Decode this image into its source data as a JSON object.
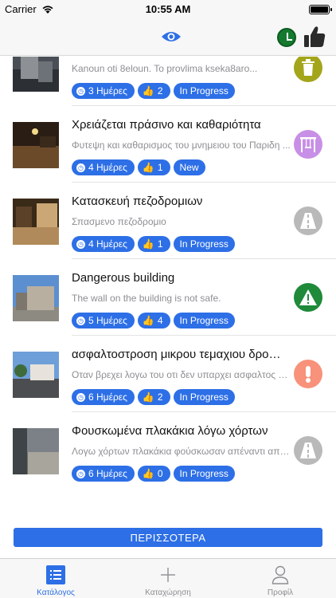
{
  "status_bar": {
    "carrier": "Carrier",
    "time": "10:55 AM"
  },
  "colors": {
    "accent": "#2d6fe6",
    "icon_eye": "#2d6fe6",
    "clock_green": "#157a2f",
    "tab_inactive": "#8e8e93"
  },
  "nav": {
    "left_icon": "eye-icon",
    "right_icons": [
      "clock-icon",
      "thumbs-up-icon"
    ]
  },
  "reports": [
    {
      "title": "",
      "description": "Kanoun oti 8eloun. To provlima kseka8aro...",
      "days": "3 Ημέρες",
      "likes": "2",
      "status": "In Progress",
      "category_icon": "trash-bin-icon",
      "category_color": "#a3a51b"
    },
    {
      "title": "Χρειάζεται πράσινο και καθαριότητα",
      "description": "Φυτεψη και καθαρισμος του μνημειου του Παριδη ...",
      "days": "4 Ημέρες",
      "likes": "1",
      "status": "New",
      "category_icon": "swing-playground-icon",
      "category_color": "#c88fe6"
    },
    {
      "title": "Κατασκευή πεζοδρομιων",
      "description": "Σπασμενο πεζοδρομιο",
      "days": "4 Ημέρες",
      "likes": "1",
      "status": "In Progress",
      "category_icon": "road-icon",
      "category_color": "#b9b9b9"
    },
    {
      "title": "Dangerous building",
      "description": "The wall on the building is not safe.",
      "days": "5 Ημέρες",
      "likes": "4",
      "status": "In Progress",
      "category_icon": "warning-icon",
      "category_color": "#1e8a3a"
    },
    {
      "title": "ασφαλτοστρoση μικρου τεμαχιου δρομου...",
      "description": "Οταν βρεχει λογω του οτι δεν υπαρχει ασφαλτος γε...",
      "days": "6 Ημέρες",
      "likes": "2",
      "status": "In Progress",
      "category_icon": "exclamation-icon",
      "category_color": "#f8927a"
    },
    {
      "title": "Φουσκωμένα πλακάκια λόγω χόρτων",
      "description": "Λογω χόρτων πλακάκια φούσκωσαν απέναντι από ...",
      "days": "6 Ημέρες",
      "likes": "0",
      "status": "In Progress",
      "category_icon": "road-icon",
      "category_color": "#b9b9b9"
    }
  ],
  "more_button": {
    "label": "ΠΕΡΙΣΣΟΤΕΡΑ"
  },
  "tabs": [
    {
      "label": "Κατάλογος",
      "icon": "list-icon",
      "active": true
    },
    {
      "label": "Καταχώρηση",
      "icon": "plus-icon",
      "active": false
    },
    {
      "label": "Προφίλ",
      "icon": "person-icon",
      "active": false
    }
  ]
}
